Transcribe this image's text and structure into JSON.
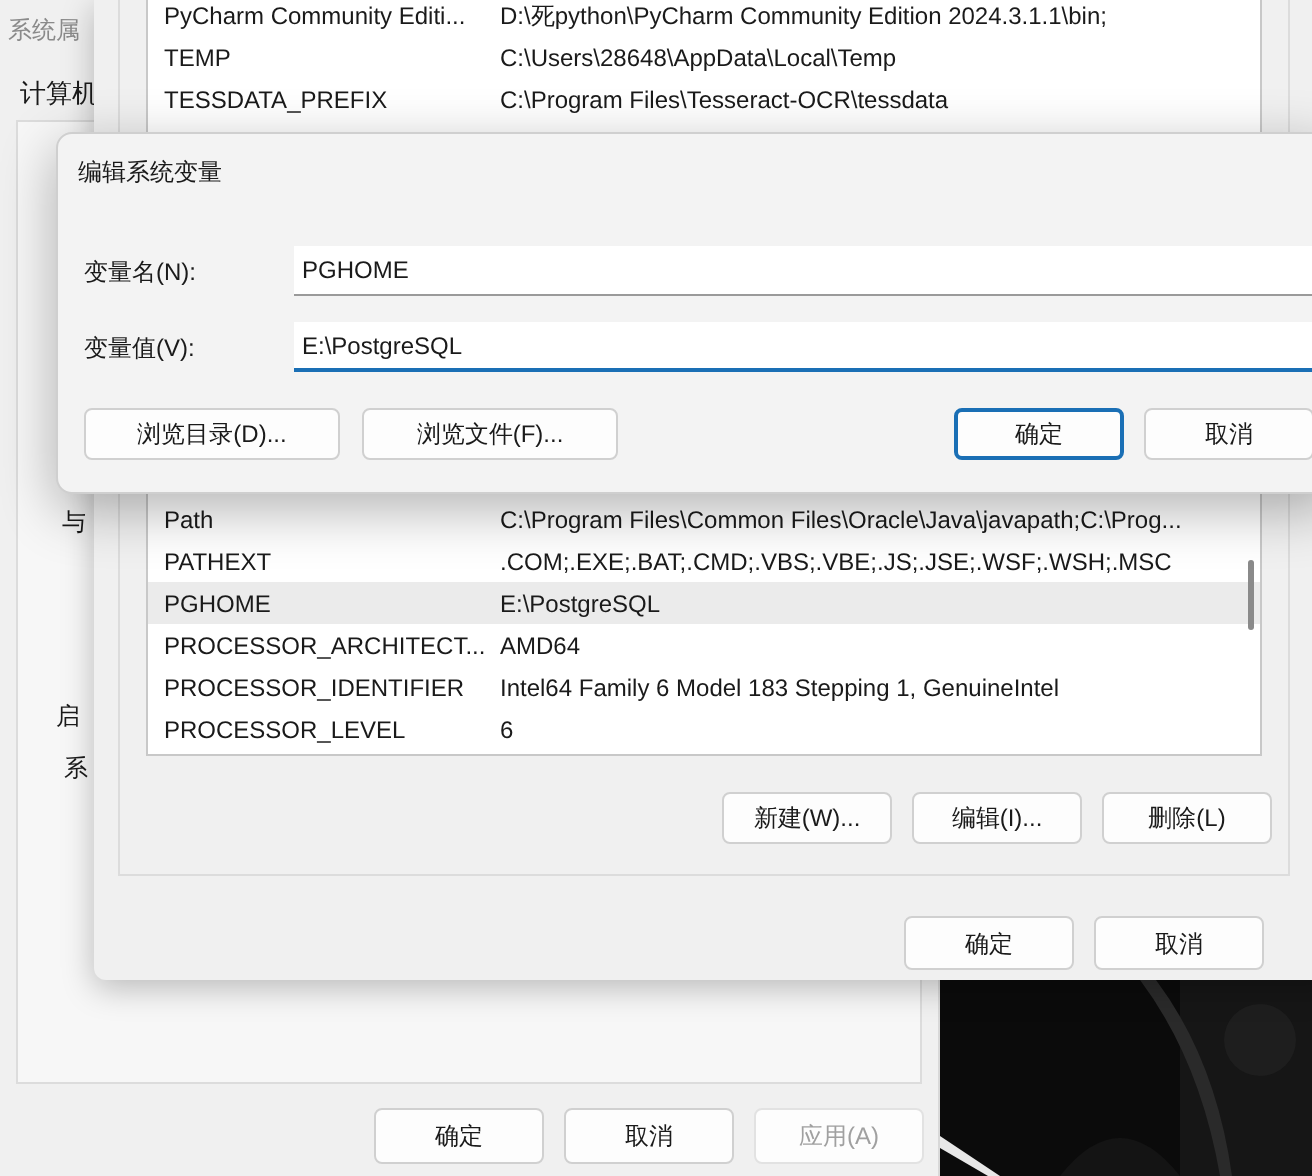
{
  "system_properties": {
    "title": "系统属",
    "tab": "计算机",
    "fragments": [
      "与",
      "启",
      "系"
    ],
    "buttons": [
      {
        "label": "确定",
        "disabled": false
      },
      {
        "label": "取消",
        "disabled": false
      },
      {
        "label": "应用(A)",
        "disabled": true
      }
    ]
  },
  "environment_variables": {
    "rows_top": [
      {
        "name": "PyCharm Community Editi...",
        "value": "D:\\死python\\PyCharm Community Edition 2024.3.1.1\\bin;",
        "selected": false
      },
      {
        "name": "TEMP",
        "value": "C:\\Users\\28648\\AppData\\Local\\Temp",
        "selected": false
      },
      {
        "name": "TESSDATA_PREFIX",
        "value": "C:\\Program Files\\Tesseract-OCR\\tessdata",
        "selected": false
      }
    ],
    "rows_bottom": [
      {
        "name": "Path",
        "value": "C:\\Program Files\\Common Files\\Oracle\\Java\\javapath;C:\\Prog...",
        "selected": false
      },
      {
        "name": "PATHEXT",
        "value": ".COM;.EXE;.BAT;.CMD;.VBS;.VBE;.JS;.JSE;.WSF;.WSH;.MSC",
        "selected": false
      },
      {
        "name": "PGHOME",
        "value": "E:\\PostgreSQL",
        "selected": true
      },
      {
        "name": "PROCESSOR_ARCHITECT...",
        "value": "AMD64",
        "selected": false
      },
      {
        "name": "PROCESSOR_IDENTIFIER",
        "value": "Intel64 Family 6 Model 183 Stepping 1, GenuineIntel",
        "selected": false
      },
      {
        "name": "PROCESSOR_LEVEL",
        "value": "6",
        "selected": false
      }
    ],
    "list_buttons": [
      "新建(W)...",
      "编辑(I)...",
      "删除(L)"
    ],
    "buttons": [
      "确定",
      "取消"
    ]
  },
  "edit_dialog": {
    "title": "编辑系统变量",
    "fields": [
      {
        "label": "变量名(N):",
        "value": "PGHOME",
        "focused": false
      },
      {
        "label": "变量值(V):",
        "value": "E:\\PostgreSQL",
        "focused": true
      }
    ],
    "browse_buttons": [
      "浏览目录(D)...",
      "浏览文件(F)..."
    ],
    "buttons": [
      {
        "label": "确定",
        "default": true
      },
      {
        "label": "取消",
        "default": false
      }
    ]
  }
}
